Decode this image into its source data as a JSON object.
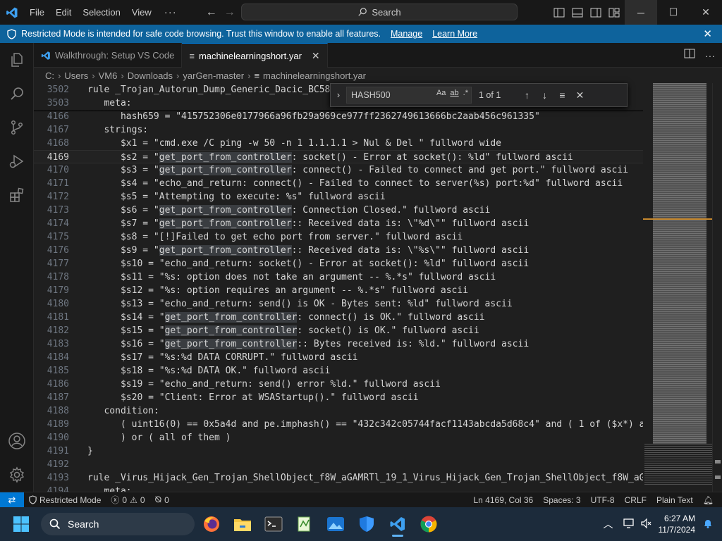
{
  "titlebar": {
    "menu": [
      "File",
      "Edit",
      "Selection",
      "View"
    ],
    "more": "···",
    "search_label": "Search"
  },
  "banner": {
    "text": "Restricted Mode is intended for safe code browsing. Trust this window to enable all features.",
    "manage": "Manage",
    "learn_more": "Learn More"
  },
  "tabs": [
    {
      "label": "Walkthrough: Setup VS Code",
      "active": false
    },
    {
      "label": "machinelearningshort.yar",
      "active": true
    }
  ],
  "breadcrumb": [
    "C:",
    "Users",
    "VM6",
    "Downloads",
    "yarGen-master",
    "machinelearningshort.yar"
  ],
  "find": {
    "query": "HASH500",
    "opt_case": "Aa",
    "opt_word": "ab",
    "opt_regex": ".*",
    "count": "1 of 1"
  },
  "editor": {
    "lines": [
      {
        "n": "3502",
        "code": "rule _Trojan_Autorun_Dump_Generic_Dacic_BC58E"
      },
      {
        "n": "3503",
        "code": "   meta:"
      },
      {
        "n": "4166",
        "code": "      hash659 = \"415752306e0177966a96fb29a969ce977ff2362749613666bc2aab456c961335\""
      },
      {
        "n": "4167",
        "code": "   strings:"
      },
      {
        "n": "4168",
        "code": "      $x1 = \"cmd.exe /C ping -w 50 -n 1 1.1.1.1 > Nul & Del \" fullword wide"
      },
      {
        "n": "4169",
        "code": "      $s2 = \"get_port_from_controller: socket() - Error at socket(): %ld\" fullword ascii"
      },
      {
        "n": "4170",
        "code": "      $s3 = \"get_port_from_controller: connect() - Failed to connect and get port.\" fullword ascii"
      },
      {
        "n": "4171",
        "code": "      $s4 = \"echo_and_return: connect() - Failed to connect to server(%s) port:%d\" fullword ascii"
      },
      {
        "n": "4172",
        "code": "      $s5 = \"Attempting to execute: %s\" fullword ascii"
      },
      {
        "n": "4173",
        "code": "      $s6 = \"get_port_from_controller: Connection Closed.\" fullword ascii"
      },
      {
        "n": "4174",
        "code": "      $s7 = \"get_port_from_controller:: Received data is: \\\"%d\\\"\" fullword ascii"
      },
      {
        "n": "4175",
        "code": "      $s8 = \"[!]Failed to get echo port from server.\" fullword ascii"
      },
      {
        "n": "4176",
        "code": "      $s9 = \"get_port_from_controller:: Received data is: \\\"%s\\\"\" fullword ascii"
      },
      {
        "n": "4177",
        "code": "      $s10 = \"echo_and_return: socket() - Error at socket(): %ld\" fullword ascii"
      },
      {
        "n": "4178",
        "code": "      $s11 = \"%s: option does not take an argument -- %.*s\" fullword ascii"
      },
      {
        "n": "4179",
        "code": "      $s12 = \"%s: option requires an argument -- %.*s\" fullword ascii"
      },
      {
        "n": "4180",
        "code": "      $s13 = \"echo_and_return: send() is OK - Bytes sent: %ld\" fullword ascii"
      },
      {
        "n": "4181",
        "code": "      $s14 = \"get_port_from_controller: connect() is OK.\" fullword ascii"
      },
      {
        "n": "4182",
        "code": "      $s15 = \"get_port_from_controller: socket() is OK.\" fullword ascii"
      },
      {
        "n": "4183",
        "code": "      $s16 = \"get_port_from_controller:: Bytes received is: %ld.\" fullword ascii"
      },
      {
        "n": "4184",
        "code": "      $s17 = \"%s:%d DATA CORRUPT.\" fullword ascii"
      },
      {
        "n": "4185",
        "code": "      $s18 = \"%s:%d DATA OK.\" fullword ascii"
      },
      {
        "n": "4186",
        "code": "      $s19 = \"echo_and_return: send() error %ld.\" fullword ascii"
      },
      {
        "n": "4187",
        "code": "      $s20 = \"Client: Error at WSAStartup().\" fullword ascii"
      },
      {
        "n": "4188",
        "code": "   condition:"
      },
      {
        "n": "4189",
        "code": "      ( uint16(0) == 0x5a4d and pe.imphash() == \"432c342c05744facf1143abcda5d68c4\" and ( 1 of ($x*) a"
      },
      {
        "n": "4190",
        "code": "      ) or ( all of them )"
      },
      {
        "n": "4191",
        "code": "}"
      },
      {
        "n": "4192",
        "code": ""
      },
      {
        "n": "4193",
        "code": "rule _Virus_Hijack_Gen_Trojan_ShellObject_f8W_aGAMRTl_19_1_Virus_Hijack_Gen_Trojan_ShellObject_f8W_aG"
      },
      {
        "n": "4194",
        "code": "   meta:"
      }
    ],
    "current_line": "4169",
    "highlight_token": "get_port_from_controller"
  },
  "statusbar": {
    "restricted": "Restricted Mode",
    "errors": "0",
    "warnings": "0",
    "ports": "0",
    "position": "Ln 4169, Col 36",
    "spaces": "Spaces: 3",
    "encoding": "UTF-8",
    "eol": "CRLF",
    "language": "Plain Text"
  },
  "taskbar": {
    "search": "Search",
    "time": "6:27 AM",
    "date": "11/7/2024"
  },
  "colors": {
    "accent": "#0078d4",
    "banner": "#0e639c"
  }
}
